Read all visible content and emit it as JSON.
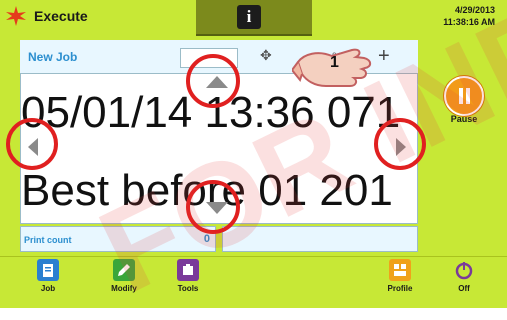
{
  "header": {
    "title": "Execute",
    "info_icon_glyph": "i",
    "date": "4/29/2013",
    "time": "11:38:16 AM"
  },
  "job": {
    "label": "New Job",
    "percent": "%",
    "plus": "+",
    "line1": "05/01/14 13:36 071",
    "line2": "Best before 01 201"
  },
  "counter": {
    "label": "Print count",
    "value": "0"
  },
  "side": {
    "pause_label": "Pause"
  },
  "footer": {
    "items": [
      {
        "label": "Job"
      },
      {
        "label": "Modify"
      },
      {
        "label": "Tools"
      },
      {
        "label": "Profile"
      },
      {
        "label": "Off"
      }
    ]
  },
  "annotation": {
    "step_number": "1",
    "watermark": "FOR INFO"
  },
  "colors": {
    "accent": "#c7e836",
    "annotation_red": "#e02020",
    "pause_orange": "#f29b1a",
    "label_blue": "#2c8fcf"
  }
}
